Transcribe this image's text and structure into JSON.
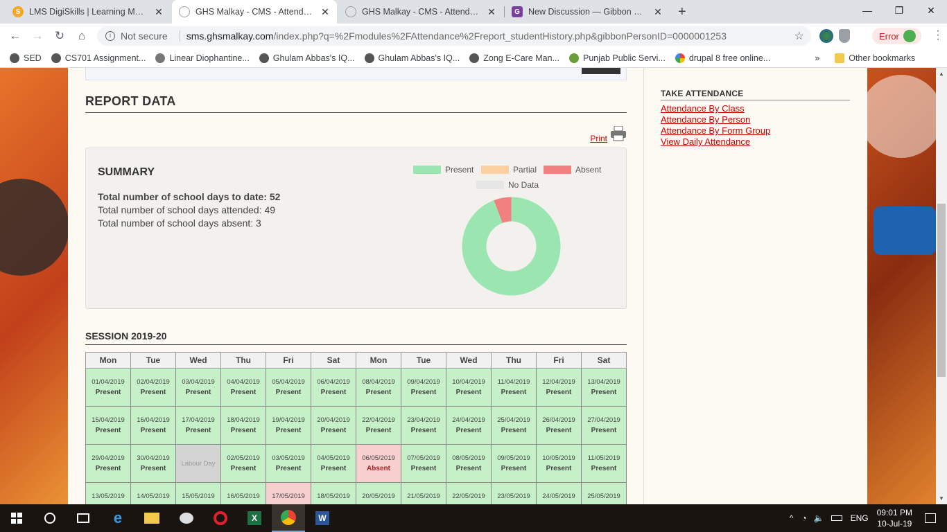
{
  "tabs": [
    {
      "title": "LMS DigiSkills | Learning Manage",
      "favicon": "lms-icon",
      "color": "#f5a623"
    },
    {
      "title": "GHS Malkay - CMS - Attendance",
      "favicon": "globe-icon",
      "color": "#9e9e9e"
    },
    {
      "title": "GHS Malkay - CMS - Attendance",
      "favicon": "globe-icon",
      "color": "#9e9e9e"
    },
    {
      "title": "New Discussion — Gibbon Suppo",
      "favicon": "gibbon-icon",
      "color": "#7b3fa0"
    }
  ],
  "omnibar": {
    "security": "Not secure",
    "host": "sms.ghsmalkay.com",
    "path": "/index.php?q=%2Fmodules%2FAttendance%2Freport_studentHistory.php&gibbonPersonID=0000001253",
    "error_label": "Error"
  },
  "bookmarks": [
    {
      "label": "SED"
    },
    {
      "label": "CS701 Assignment..."
    },
    {
      "label": "Linear Diophantine..."
    },
    {
      "label": "Ghulam Abbas's IQ..."
    },
    {
      "label": "Ghulam Abbas's IQ..."
    },
    {
      "label": "Zong E-Care   Man..."
    },
    {
      "label": "Punjab Public Servi..."
    },
    {
      "label": "drupal 8 free online..."
    }
  ],
  "bookmarks_more": "»",
  "other_bookmarks": "Other bookmarks",
  "report": {
    "title": "REPORT DATA",
    "print_label": "Print"
  },
  "summary": {
    "title": "SUMMARY",
    "line1": "Total number of school days to date: 52",
    "line2": "Total number of school days attended: 49",
    "line3": "Total number of school days absent: 3",
    "legend": [
      {
        "label": "Present",
        "color": "#9be5b0"
      },
      {
        "label": "Partial",
        "color": "#fdd0a2"
      },
      {
        "label": "Absent",
        "color": "#f28080"
      },
      {
        "label": "No Data",
        "color": "#e6e6e6"
      }
    ]
  },
  "chart_data": {
    "type": "pie",
    "title": "",
    "slices": [
      {
        "label": "Present",
        "value": 49,
        "color": "#9be5b0"
      },
      {
        "label": "Absent",
        "value": 3,
        "color": "#f28080"
      }
    ]
  },
  "session": {
    "title": "SESSION 2019-20",
    "days": [
      "Mon",
      "Tue",
      "Wed",
      "Thu",
      "Fri",
      "Sat",
      "Mon",
      "Tue",
      "Wed",
      "Thu",
      "Fri",
      "Sat"
    ],
    "rows": [
      [
        {
          "date": "01/04/2019",
          "status": "Present",
          "type": "present"
        },
        {
          "date": "02/04/2019",
          "status": "Present",
          "type": "present"
        },
        {
          "date": "03/04/2019",
          "status": "Present",
          "type": "present"
        },
        {
          "date": "04/04/2019",
          "status": "Present",
          "type": "present"
        },
        {
          "date": "05/04/2019",
          "status": "Present",
          "type": "present"
        },
        {
          "date": "06/04/2019",
          "status": "Present",
          "type": "present"
        },
        {
          "date": "08/04/2019",
          "status": "Present",
          "type": "present"
        },
        {
          "date": "09/04/2019",
          "status": "Present",
          "type": "present"
        },
        {
          "date": "10/04/2019",
          "status": "Present",
          "type": "present"
        },
        {
          "date": "11/04/2019",
          "status": "Present",
          "type": "present"
        },
        {
          "date": "12/04/2019",
          "status": "Present",
          "type": "present"
        },
        {
          "date": "13/04/2019",
          "status": "Present",
          "type": "present"
        }
      ],
      [
        {
          "date": "15/04/2019",
          "status": "Present",
          "type": "present"
        },
        {
          "date": "16/04/2019",
          "status": "Present",
          "type": "present"
        },
        {
          "date": "17/04/2019",
          "status": "Present",
          "type": "present"
        },
        {
          "date": "18/04/2019",
          "status": "Present",
          "type": "present"
        },
        {
          "date": "19/04/2019",
          "status": "Present",
          "type": "present"
        },
        {
          "date": "20/04/2019",
          "status": "Present",
          "type": "present"
        },
        {
          "date": "22/04/2019",
          "status": "Present",
          "type": "present"
        },
        {
          "date": "23/04/2019",
          "status": "Present",
          "type": "present"
        },
        {
          "date": "24/04/2019",
          "status": "Present",
          "type": "present"
        },
        {
          "date": "25/04/2019",
          "status": "Present",
          "type": "present"
        },
        {
          "date": "26/04/2019",
          "status": "Present",
          "type": "present"
        },
        {
          "date": "27/04/2019",
          "status": "Present",
          "type": "present"
        }
      ],
      [
        {
          "date": "29/04/2019",
          "status": "Present",
          "type": "present"
        },
        {
          "date": "30/04/2019",
          "status": "Present",
          "type": "present"
        },
        {
          "date": "Labour Day",
          "status": "",
          "type": "holiday"
        },
        {
          "date": "02/05/2019",
          "status": "Present",
          "type": "present"
        },
        {
          "date": "03/05/2019",
          "status": "Present",
          "type": "present"
        },
        {
          "date": "04/05/2019",
          "status": "Present",
          "type": "present"
        },
        {
          "date": "06/05/2019",
          "status": "Absent",
          "type": "absent"
        },
        {
          "date": "07/05/2019",
          "status": "Present",
          "type": "present"
        },
        {
          "date": "08/05/2019",
          "status": "Present",
          "type": "present"
        },
        {
          "date": "09/05/2019",
          "status": "Present",
          "type": "present"
        },
        {
          "date": "10/05/2019",
          "status": "Present",
          "type": "present"
        },
        {
          "date": "11/05/2019",
          "status": "Present",
          "type": "present"
        }
      ],
      [
        {
          "date": "13/05/2019",
          "status": "",
          "type": "present"
        },
        {
          "date": "14/05/2019",
          "status": "",
          "type": "present"
        },
        {
          "date": "15/05/2019",
          "status": "",
          "type": "present"
        },
        {
          "date": "16/05/2019",
          "status": "",
          "type": "present"
        },
        {
          "date": "17/05/2019",
          "status": "",
          "type": "absent"
        },
        {
          "date": "18/05/2019",
          "status": "",
          "type": "present"
        },
        {
          "date": "20/05/2019",
          "status": "",
          "type": "present"
        },
        {
          "date": "21/05/2019",
          "status": "",
          "type": "present"
        },
        {
          "date": "22/05/2019",
          "status": "",
          "type": "present"
        },
        {
          "date": "23/05/2019",
          "status": "",
          "type": "present"
        },
        {
          "date": "24/05/2019",
          "status": "",
          "type": "present"
        },
        {
          "date": "25/05/2019",
          "status": "",
          "type": "present"
        }
      ]
    ]
  },
  "sidebar": {
    "heading": "TAKE ATTENDANCE",
    "links": [
      "Attendance By Class",
      "Attendance By Person",
      "Attendance By Form Group",
      "View Daily Attendance"
    ]
  },
  "taskbar": {
    "lang": "ENG",
    "time": "09:01 PM",
    "date": "10-Jul-19"
  }
}
